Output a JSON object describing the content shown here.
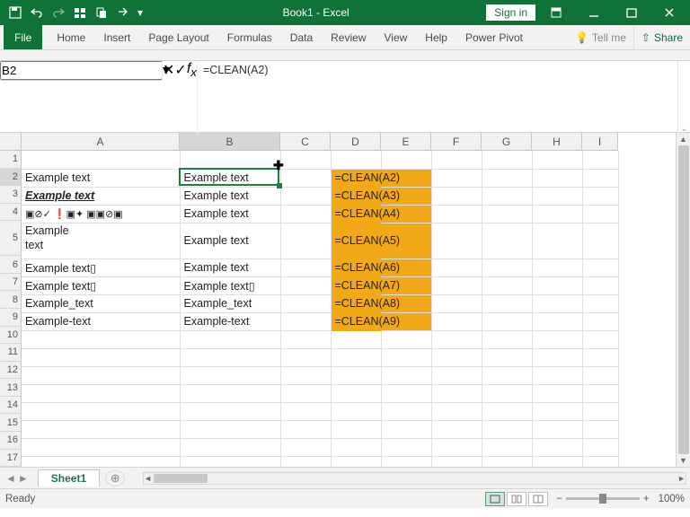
{
  "titlebar": {
    "title": "Book1 - Excel",
    "signin": "Sign in"
  },
  "ribbon": {
    "tabs": [
      "File",
      "Home",
      "Insert",
      "Page Layout",
      "Formulas",
      "Data",
      "Review",
      "View",
      "Help",
      "Power Pivot"
    ],
    "tellme": "Tell me",
    "share": "Share"
  },
  "namebox": {
    "value": "B2"
  },
  "formula": {
    "value": "=CLEAN(A2)"
  },
  "columns": [
    "A",
    "B",
    "C",
    "D",
    "E",
    "F",
    "G",
    "H",
    "I"
  ],
  "col_widths": {
    "A": 176,
    "B": 112,
    "C": 56,
    "D": 56,
    "E": 56,
    "F": 56,
    "G": 56,
    "H": 56,
    "I": 40
  },
  "rows": [
    1,
    2,
    3,
    4,
    5,
    6,
    7,
    8,
    9,
    10,
    11,
    12,
    13,
    14,
    15,
    16,
    17
  ],
  "row_heights": {
    "5": 40
  },
  "selection": {
    "cell": "B2",
    "col": "B",
    "row": 2
  },
  "cells": {
    "A2": {
      "v": "Example text"
    },
    "A3": {
      "v": "Example text",
      "style": "bolditalic"
    },
    "A4": {
      "v": "",
      "special": "glyphrow"
    },
    "A5": {
      "v": "Example\ntext"
    },
    "A6": {
      "v": "Example text▯"
    },
    "A7": {
      "v": "Example text▯"
    },
    "A8": {
      "v": "Example_text"
    },
    "A9": {
      "v": "Example-text"
    },
    "B2": {
      "v": "Example text"
    },
    "B3": {
      "v": "Example text"
    },
    "B4": {
      "v": "Example text"
    },
    "B5": {
      "v": "Example text"
    },
    "B6": {
      "v": "Example text"
    },
    "B7": {
      "v": "Example text▯"
    },
    "B8": {
      "v": "Example_text"
    },
    "B9": {
      "v": "Example-text"
    },
    "D2": {
      "v": "=CLEAN(A2)",
      "hl": true
    },
    "D3": {
      "v": "=CLEAN(A3)",
      "hl": true
    },
    "D4": {
      "v": "=CLEAN(A4)",
      "hl": true
    },
    "D5": {
      "v": "=CLEAN(A5)",
      "hl": true
    },
    "D6": {
      "v": "=CLEAN(A6)",
      "hl": true
    },
    "D7": {
      "v": "=CLEAN(A7)",
      "hl": true
    },
    "D8": {
      "v": "=CLEAN(A8)",
      "hl": true
    },
    "D9": {
      "v": "=CLEAN(A9)",
      "hl": true
    }
  },
  "glyph_row_text": "▣⊘✓ ❗▣✦ ▣▣⊘▣",
  "sheet_tabs": {
    "active": "Sheet1"
  },
  "statusbar": {
    "status": "Ready",
    "zoom": "100%"
  }
}
